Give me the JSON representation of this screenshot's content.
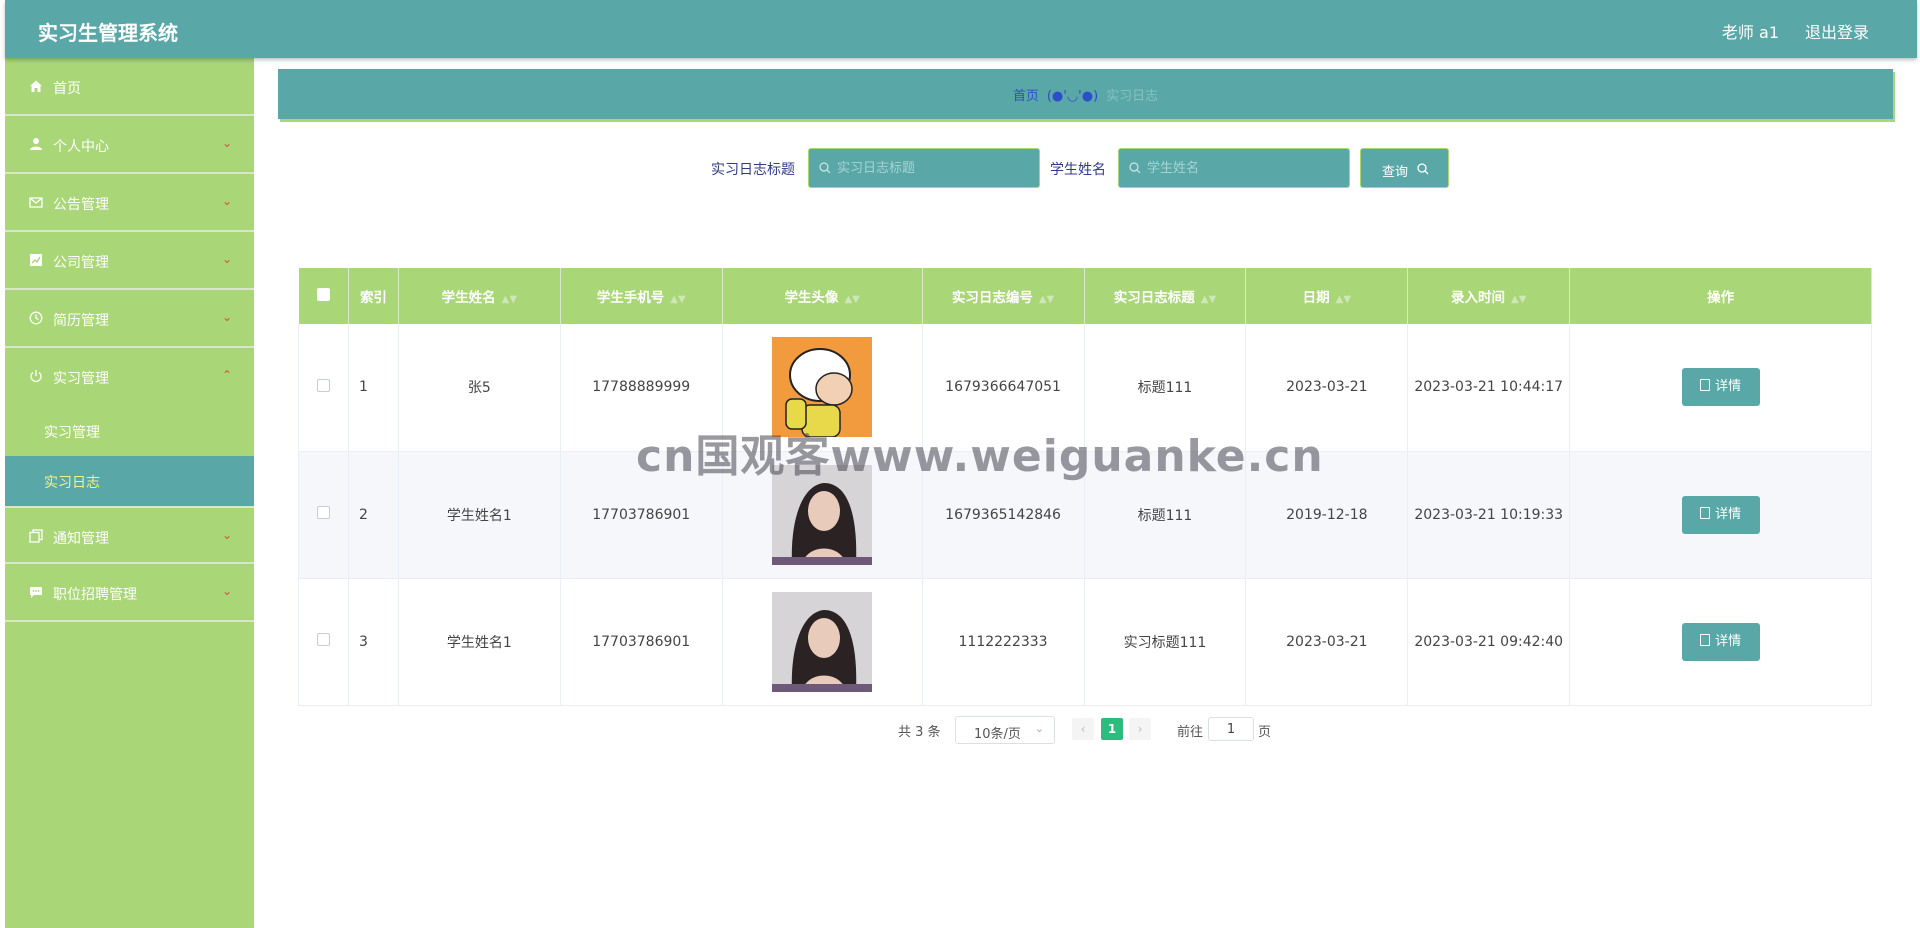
{
  "header": {
    "app_title": "实习生管理系统",
    "user": "老师 a1",
    "logout": "退出登录"
  },
  "sidebar": {
    "items": [
      {
        "label": "首页",
        "icon": "home-icon"
      },
      {
        "label": "个人中心",
        "icon": "user-icon"
      },
      {
        "label": "公告管理",
        "icon": "mail-icon"
      },
      {
        "label": "公司管理",
        "icon": "chart-icon"
      },
      {
        "label": "简历管理",
        "icon": "clock-icon"
      },
      {
        "label": "实习管理",
        "icon": "power-icon",
        "expanded": true,
        "children": [
          {
            "label": "实习管理"
          },
          {
            "label": "实习日志",
            "active": true
          }
        ]
      },
      {
        "label": "通知管理",
        "icon": "copy-icon"
      },
      {
        "label": "职位招聘管理",
        "icon": "message-icon"
      }
    ]
  },
  "breadcrumb": {
    "home": "首页",
    "separator": "(●'◡'●)",
    "current": "实习日志"
  },
  "search": {
    "title_label": "实习日志标题",
    "title_placeholder": "实习日志标题",
    "name_label": "学生姓名",
    "name_placeholder": "学生姓名",
    "query_button": "查询"
  },
  "table": {
    "headers": [
      "索引",
      "学生姓名",
      "学生手机号",
      "学生头像",
      "实习日志编号",
      "实习日志标题",
      "日期",
      "录入时间",
      "操作"
    ],
    "rows": [
      {
        "index": "1",
        "name": "张5",
        "phone": "17788889999",
        "avatar": "cartoon-boy",
        "log_no": "1679366647051",
        "title": "标题111",
        "date": "2023-03-21",
        "created": "2023-03-21 10:44:17",
        "action": "详情"
      },
      {
        "index": "2",
        "name": "学生姓名1",
        "phone": "17703786901",
        "avatar": "woman-portrait",
        "log_no": "1679365142846",
        "title": "标题111",
        "date": "2019-12-18",
        "created": "2023-03-21 10:19:33",
        "action": "详情"
      },
      {
        "index": "3",
        "name": "学生姓名1",
        "phone": "17703786901",
        "avatar": "woman-portrait",
        "log_no": "1112222333",
        "title": "实习标题111",
        "date": "2023-03-21",
        "created": "2023-03-21 09:42:40",
        "action": "详情"
      }
    ]
  },
  "pagination": {
    "total": "共 3 条",
    "page_size": "10条/页",
    "current_page": "1",
    "goto_label": "前往",
    "goto_value": "1",
    "goto_unit": "页"
  },
  "watermark": "cn国观客www.weiguanke.cn",
  "colors": {
    "header": "#5aa7a8",
    "sidebar": "#a9d676",
    "active": "#5aa7a8",
    "pager_current": "#2bbd7e"
  }
}
